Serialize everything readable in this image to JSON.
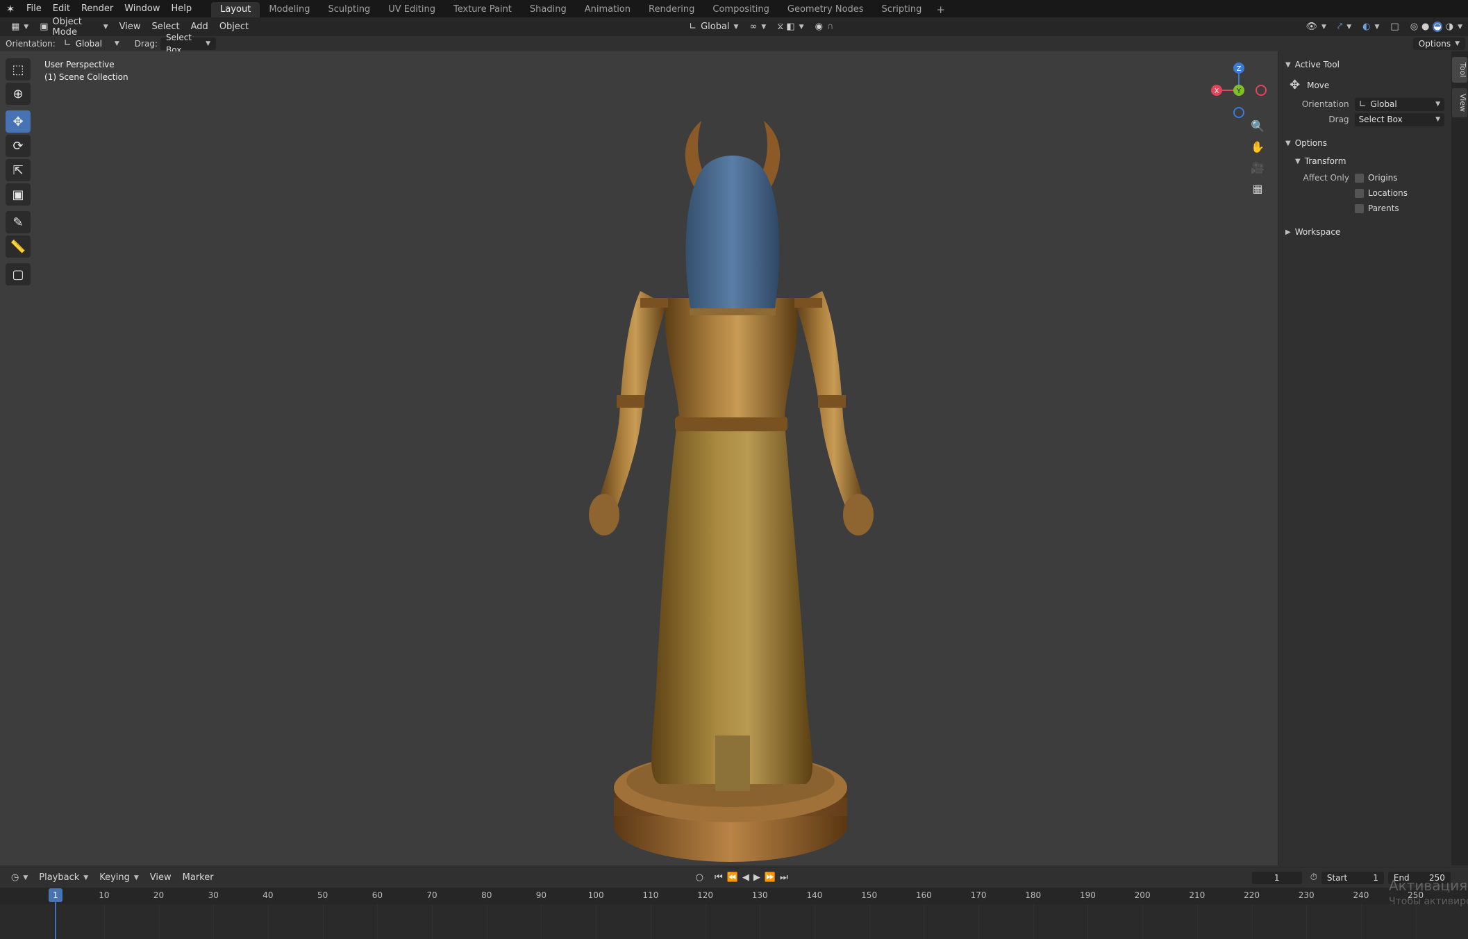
{
  "menu": {
    "items": [
      "File",
      "Edit",
      "Render",
      "Window",
      "Help"
    ]
  },
  "workspaces": {
    "tabs": [
      "Layout",
      "Modeling",
      "Sculpting",
      "UV Editing",
      "Texture Paint",
      "Shading",
      "Animation",
      "Rendering",
      "Compositing",
      "Geometry Nodes",
      "Scripting"
    ],
    "active": "Layout"
  },
  "header": {
    "mode": "Object Mode",
    "menus": [
      "View",
      "Select",
      "Add",
      "Object"
    ],
    "transform_orientation": "Global",
    "options_label": "Options"
  },
  "toolsettings": {
    "orientation_label": "Orientation:",
    "orientation_value": "Global",
    "drag_label": "Drag:",
    "drag_value": "Select Box"
  },
  "viewport": {
    "perspective": "User Perspective",
    "collection": "(1) Scene Collection",
    "gizmo": {
      "z_label": "Z",
      "y_label": "Y",
      "x_label": "X"
    }
  },
  "tools": [
    "select-box-icon",
    "cursor-icon",
    "move-icon",
    "rotate-icon",
    "scale-icon",
    "transform-icon",
    "annotate-icon",
    "measure-icon",
    "add-cube-icon"
  ],
  "npanel": {
    "active_tool": "Active Tool",
    "tool_name": "Move",
    "orientation_label": "Orientation",
    "orientation_value": "Global",
    "drag_label": "Drag",
    "drag_value": "Select Box",
    "options": "Options",
    "transform": "Transform",
    "affect_only": "Affect Only",
    "origins": "Origins",
    "locations": "Locations",
    "parents": "Parents",
    "workspace": "Workspace",
    "tabs": [
      "Tool",
      "View"
    ]
  },
  "timeline": {
    "menus": [
      "Playback",
      "Keying",
      "View",
      "Marker"
    ],
    "current_frame": "1",
    "start_label": "Start",
    "start_value": "1",
    "end_label": "End",
    "end_value": "250",
    "ruler": [
      "1",
      "10",
      "20",
      "30",
      "40",
      "50",
      "60",
      "70",
      "80",
      "90",
      "100",
      "110",
      "120",
      "130",
      "140",
      "150",
      "160",
      "170",
      "180",
      "190",
      "200",
      "210",
      "220",
      "230",
      "240",
      "250"
    ]
  },
  "watermark": {
    "line1": "Активация W",
    "line2": "Чтобы активиро"
  },
  "colors": {
    "accent": "#4772b3",
    "x_axis": "#e0455a",
    "y_axis": "#7fbf2a",
    "z_axis": "#3a7bd5",
    "bronze": "#9c7434",
    "hair": "#4d6f94"
  }
}
